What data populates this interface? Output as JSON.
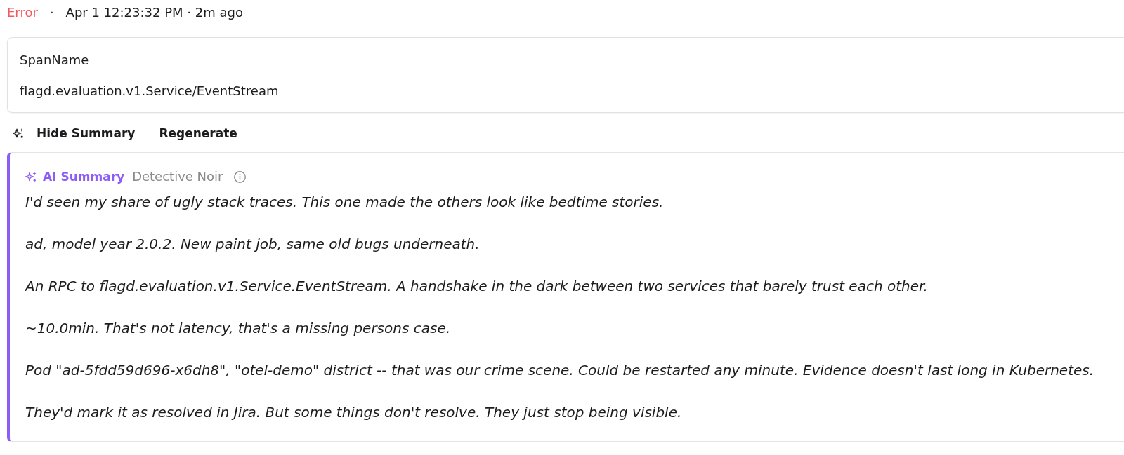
{
  "status": {
    "label": "Error",
    "kind": "error"
  },
  "separator": "·",
  "timestamp": "Apr 1 12:23:32 PM · 2m ago",
  "attribute": {
    "label": "SpanName",
    "value": "flagd.evaluation.v1.Service/EventStream"
  },
  "actions": [
    {
      "label": "Hide Summary",
      "kind": "toggle"
    },
    {
      "label": "Regenerate",
      "kind": "plain"
    }
  ],
  "summary": {
    "title": "AI Summary",
    "style": "Detective Noir",
    "paragraphs": [
      "I'd seen my share of ugly stack traces. This one made the others look like bedtime stories.",
      "ad, model year 2.0.2. New paint job, same old bugs underneath.",
      "An RPC to flagd.evaluation.v1.Service.EventStream. A handshake in the dark between two services that barely trust each other.",
      "~10.0min. That's not latency, that's a missing persons case.",
      "Pod \"ad-5fdd59d696-x6dh8\", \"otel-demo\" district -- that was our crime scene. Could be restarted any minute. Evidence doesn't last long in Kubernetes.",
      "They'd mark it as resolved in Jira. But some things don't resolve. They just stop being visible."
    ]
  }
}
